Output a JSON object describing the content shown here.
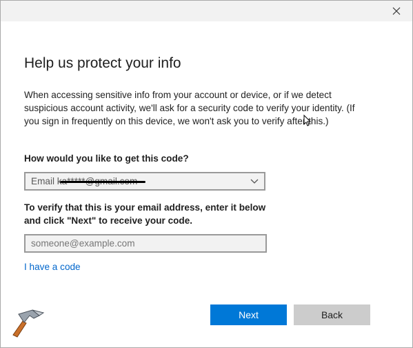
{
  "window": {
    "close_icon": "close-icon"
  },
  "content": {
    "title": "Help us protect your info",
    "description": "When accessing sensitive info from your account or device, or if we detect suspicious account activity, we'll ask for a security code to verify your identity. (If you sign in frequently on this device, we won't ask you to verify after this.)",
    "method_question": "How would you like to get this code?",
    "method_select": {
      "selected_value": "Email ka*****@gmail.com",
      "icon": "chevron-down-icon"
    },
    "verify_instruction": "To verify that this is your email address, enter it below and click \"Next\" to receive your code.",
    "email_input": {
      "value": "",
      "placeholder": "someone@example.com"
    },
    "have_code_link": "I have a code"
  },
  "buttons": {
    "next_label": "Next",
    "back_label": "Back"
  },
  "colors": {
    "accent": "#0078d7",
    "link": "#0066cc",
    "secondary_button": "#cccccc",
    "titlebar": "#f2f2f2"
  },
  "watermark": {
    "icon": "hammer-logo-icon"
  }
}
